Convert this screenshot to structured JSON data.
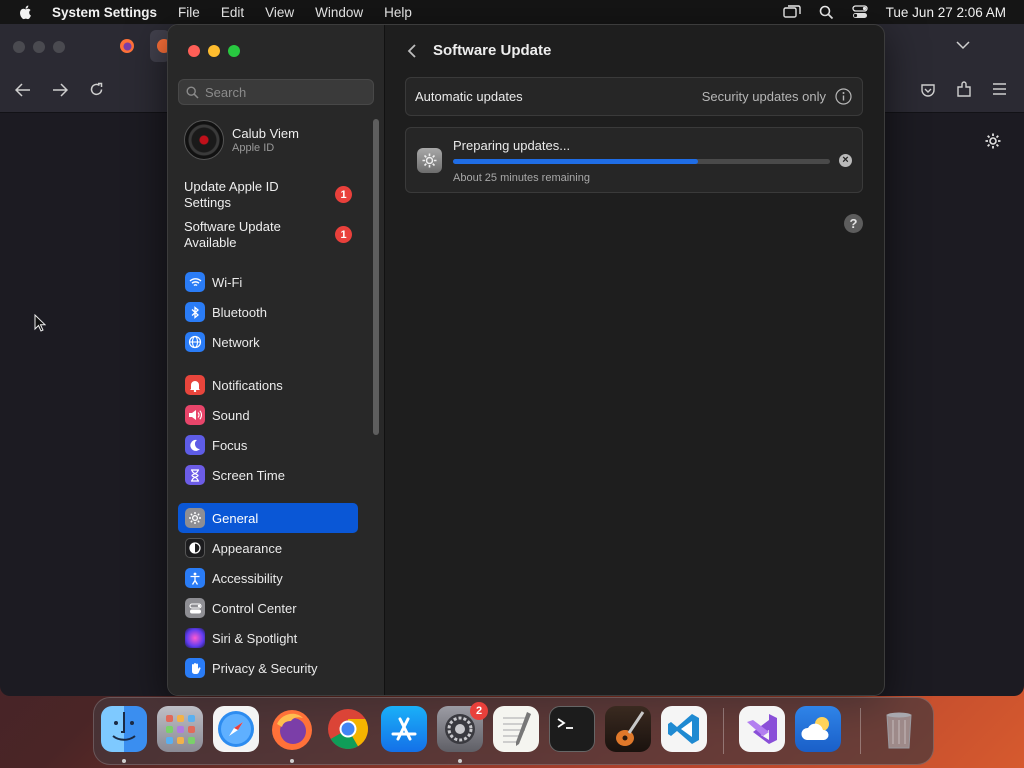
{
  "menubar": {
    "app_name": "System Settings",
    "items": [
      "File",
      "Edit",
      "View",
      "Window",
      "Help"
    ],
    "clock": "Tue Jun 27  2:06 AM"
  },
  "sidebar": {
    "search_placeholder": "Search",
    "account": {
      "name": "Calub Viem",
      "subtitle": "Apple ID"
    },
    "notices": [
      {
        "label": "Update Apple ID Settings",
        "badge": "1"
      },
      {
        "label": "Software Update Available",
        "badge": "1"
      }
    ],
    "items": [
      {
        "label": "Wi-Fi",
        "icon": "wifi-icon",
        "color": "#2a7cf6"
      },
      {
        "label": "Bluetooth",
        "icon": "bluetooth-icon",
        "color": "#2a7cf6"
      },
      {
        "label": "Network",
        "icon": "globe-icon",
        "color": "#2a7cf6"
      },
      {
        "label": "Notifications",
        "icon": "bell-icon",
        "color": "#e8453c"
      },
      {
        "label": "Sound",
        "icon": "speaker-icon",
        "color": "#e8456a"
      },
      {
        "label": "Focus",
        "icon": "moon-icon",
        "color": "#5e5ce6"
      },
      {
        "label": "Screen Time",
        "icon": "hourglass-icon",
        "color": "#6c5ce6"
      },
      {
        "label": "General",
        "icon": "gear-icon",
        "color": "#8e8e93",
        "selected": true
      },
      {
        "label": "Appearance",
        "icon": "appearance-icon",
        "color": "#1c1c1e"
      },
      {
        "label": "Accessibility",
        "icon": "accessibility-icon",
        "color": "#2a7cf6"
      },
      {
        "label": "Control Center",
        "icon": "control-center-icon",
        "color": "#8e8e93"
      },
      {
        "label": "Siri & Spotlight",
        "icon": "siri-icon",
        "color": "#b04de0"
      },
      {
        "label": "Privacy & Security",
        "icon": "hand-icon",
        "color": "#2a7cf6"
      }
    ]
  },
  "main": {
    "title": "Software Update",
    "automatic_updates": {
      "label": "Automatic updates",
      "value": "Security updates only"
    },
    "update": {
      "title": "Preparing updates...",
      "subtitle": "About 25 minutes remaining",
      "progress": 0.65
    },
    "help": "?"
  },
  "dock": {
    "apps": [
      "Finder",
      "Launchpad",
      "Safari",
      "Firefox",
      "Chrome",
      "App Store",
      "System Settings",
      "TextEdit",
      "Terminal",
      "GarageBand",
      "Visual Studio Code",
      "Visual Studio",
      "Weather",
      "Trash"
    ],
    "settings_badge": "2"
  }
}
